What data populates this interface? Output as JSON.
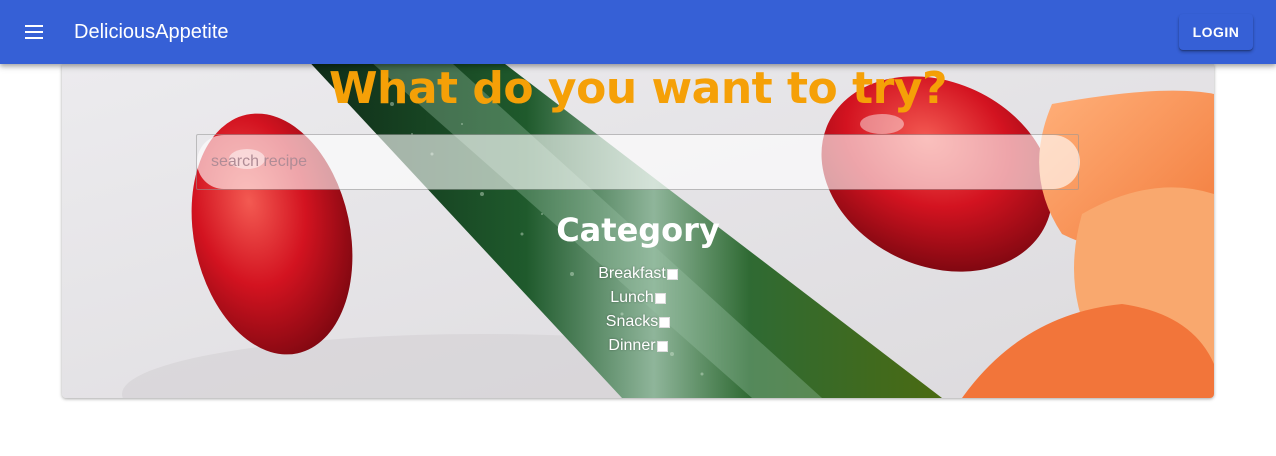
{
  "appbar": {
    "title": "DeliciousAppetite",
    "menu_icon": "menu-icon",
    "login_label": "LOGIN",
    "color": "#3660d6"
  },
  "hero": {
    "heading": "What do you want to try?",
    "heading_color": "#f5a007",
    "search": {
      "placeholder": "search recipe",
      "value": ""
    },
    "category_title": "Category",
    "categories": [
      {
        "label": "Breakfast",
        "checked": false
      },
      {
        "label": "Lunch",
        "checked": false
      },
      {
        "label": "Snacks",
        "checked": false
      },
      {
        "label": "Dinner",
        "checked": false
      }
    ],
    "background_image": "vegetables-photo"
  }
}
